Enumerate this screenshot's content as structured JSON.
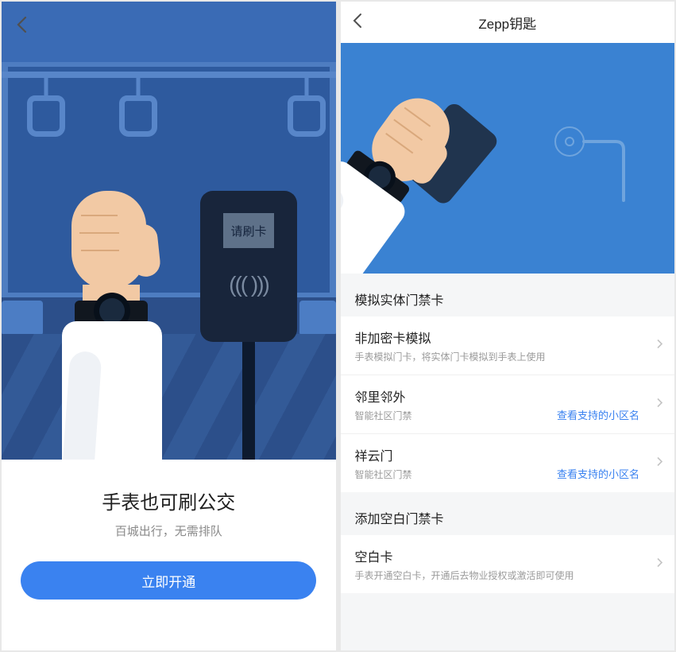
{
  "screen1": {
    "reader_label": "请刷卡",
    "title": "手表也可刷公交",
    "subtitle": "百城出行，无需排队",
    "cta": "立即开通"
  },
  "screen2": {
    "header_title": "Zepp钥匙",
    "section1_title": "模拟实体门禁卡",
    "section2_title": "添加空白门禁卡",
    "items1": [
      {
        "title": "非加密卡模拟",
        "sub": "手表模拟门卡，将实体门卡模拟到手表上使用",
        "link": ""
      },
      {
        "title": "邻里邻外",
        "sub": "智能社区门禁",
        "link": "查看支持的小区名"
      },
      {
        "title": "祥云门",
        "sub": "智能社区门禁",
        "link": "查看支持的小区名"
      }
    ],
    "items2": [
      {
        "title": "空白卡",
        "sub": "手表开通空白卡，开通后去物业授权或激活即可使用"
      }
    ]
  }
}
